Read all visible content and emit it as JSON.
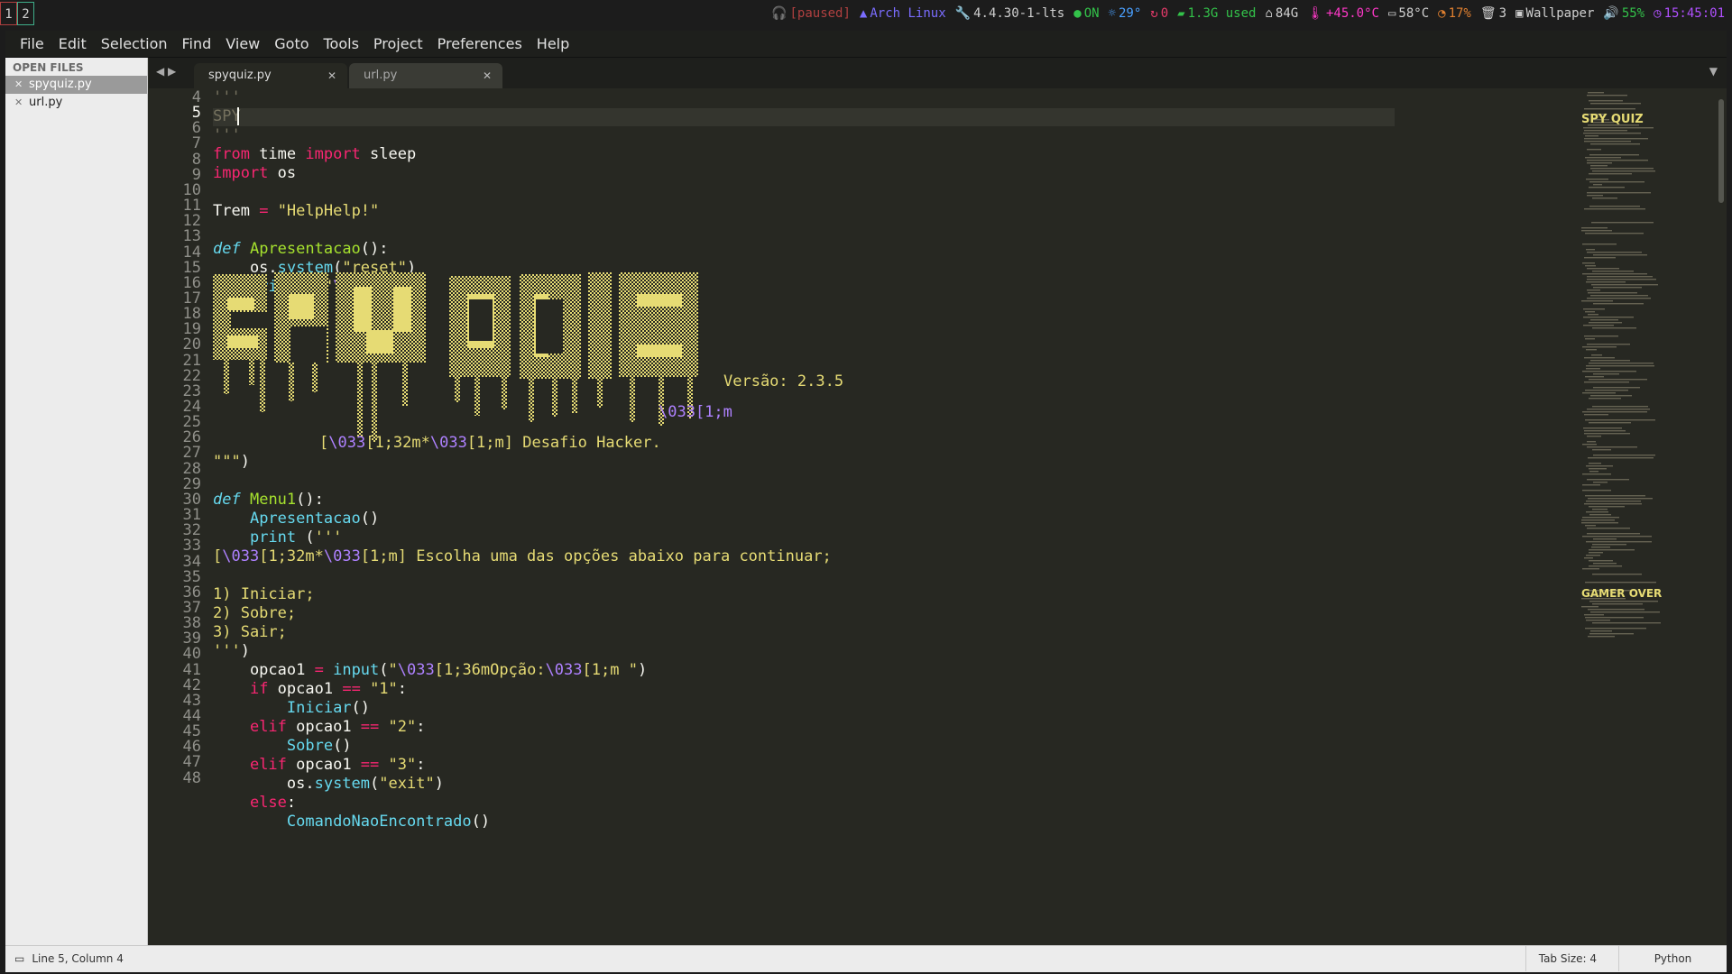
{
  "workspaces": [
    "1",
    "2"
  ],
  "status": {
    "music": "[paused]",
    "os": "Arch Linux",
    "kernel": "4.4.30-1-lts",
    "network": "ON",
    "temp": "29°",
    "updates": "0",
    "memory": "1.3G used",
    "disk": "84G",
    "gpu_temp": "+45.0°C",
    "cpu_temp": "58°C",
    "cpu": "17%",
    "trash": "3",
    "wallpaper": "Wallpaper",
    "volume": "55%",
    "time": "15:45:01",
    "colors": {
      "music": "#b04040",
      "os": "#7a6cff",
      "kernel": "#d0d0d0",
      "network": "#33c24a",
      "temp": "#4aa0ff",
      "updates": "#e53a6a",
      "memory": "#33c24a",
      "disk": "#d0d0d0",
      "gpu_temp": "#ff38c8",
      "cpu_temp": "#d0d0d0",
      "cpu": "#e08030",
      "trash": "#d0d0d0",
      "wallpaper": "#d0d0d0",
      "volume": "#33c24a",
      "time": "#b050ff"
    }
  },
  "menu": [
    "File",
    "Edit",
    "Selection",
    "Find",
    "View",
    "Goto",
    "Tools",
    "Project",
    "Preferences",
    "Help"
  ],
  "sidebar": {
    "title": "OPEN FILES",
    "files": [
      {
        "name": "spyquiz.py",
        "active": true
      },
      {
        "name": "url.py",
        "active": false
      }
    ]
  },
  "tabs": [
    {
      "label": "spyquiz.py",
      "active": true
    },
    {
      "label": "url.py",
      "active": false
    }
  ],
  "editor": {
    "line_numbers": [
      "4",
      "5",
      "6",
      "7",
      "8",
      "9",
      "10",
      "11",
      "12",
      "13",
      "14",
      "15",
      "16",
      "17",
      "18",
      "19",
      "20",
      "21",
      "22",
      "23",
      "24",
      "25",
      "26",
      "27",
      "28",
      "29",
      "30",
      "31",
      "32",
      "33",
      "34",
      "35",
      "36",
      "37",
      "38",
      "39",
      "40",
      "41",
      "42",
      "43",
      "44",
      "45",
      "46",
      "47",
      "48"
    ],
    "current_line": "5",
    "ascii_version": "Versão: 2.3.5",
    "ascii_reset": "\\033[1;m",
    "ascii_desafio_a": "[",
    "ascii_desafio_esc1": "\\033",
    "ascii_desafio_b": "[1;32m*",
    "ascii_desafio_esc2": "\\033",
    "ascii_desafio_c": "[1;m] Desafio Hacker.",
    "minimap_art_1": "SPY QUIZ",
    "minimap_art_2": "GAMER OVER"
  },
  "footer": {
    "position": "Line 5, Column 4",
    "tab_size": "Tab Size: 4",
    "syntax": "Python"
  }
}
